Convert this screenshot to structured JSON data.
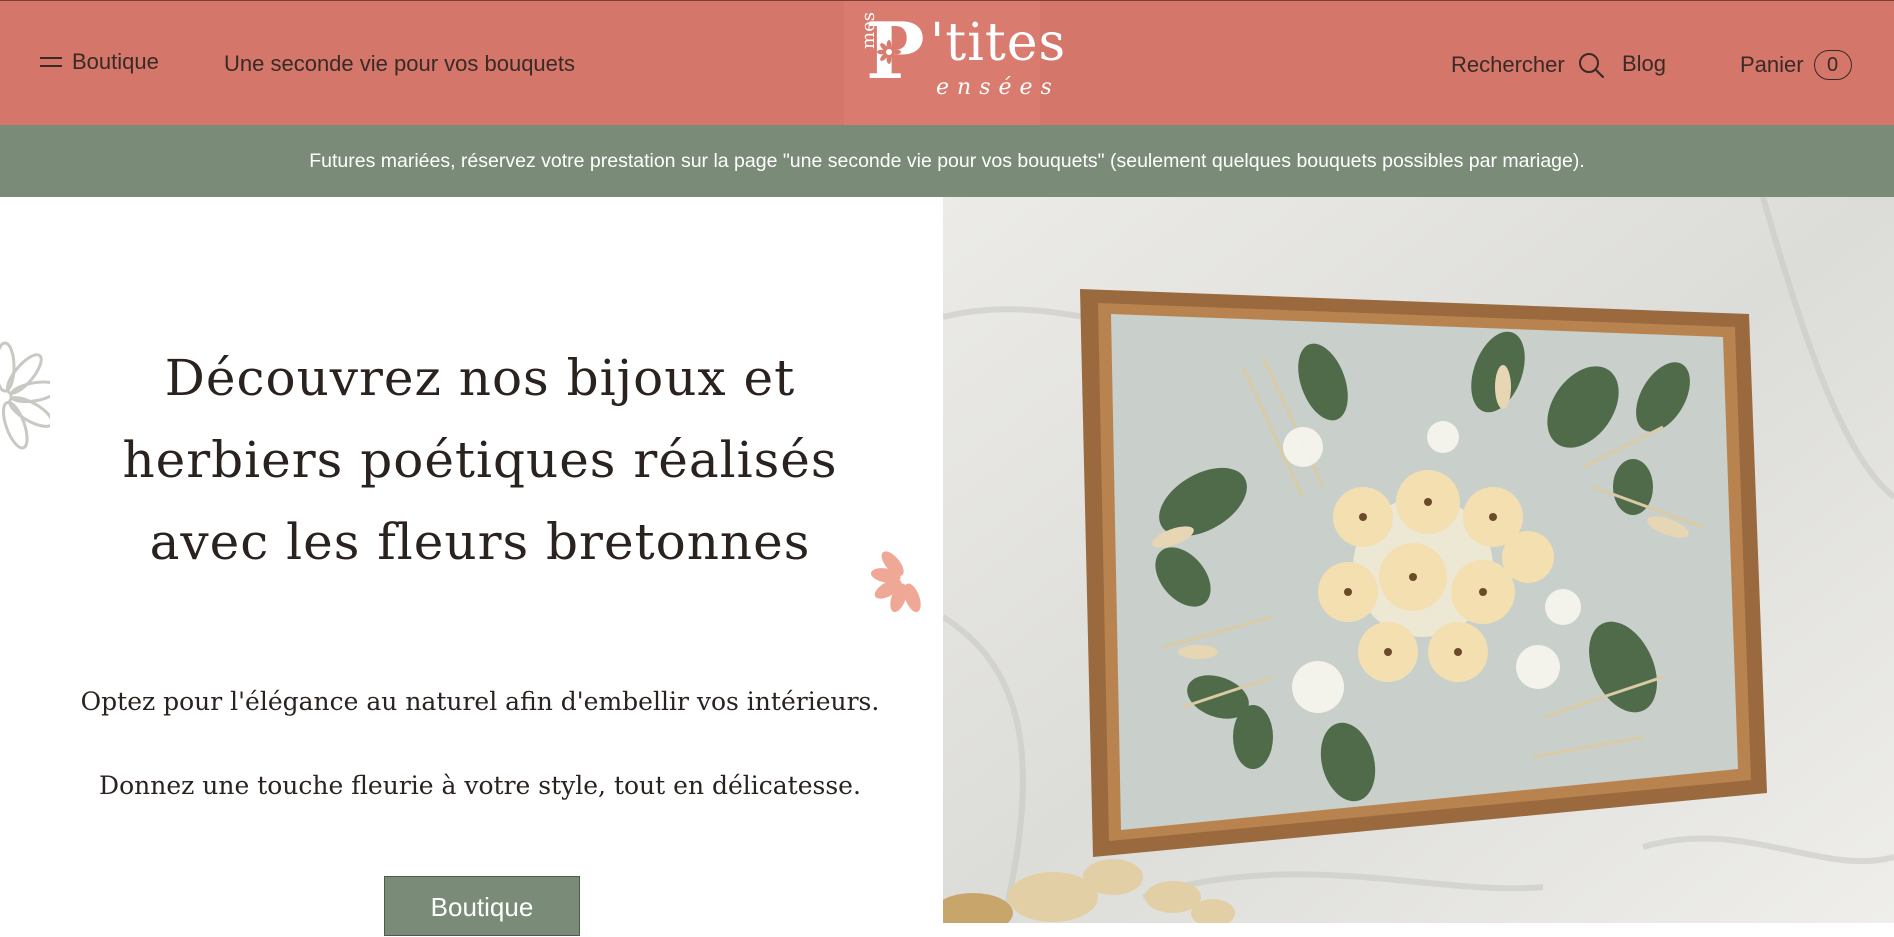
{
  "header": {
    "menu_label": "Boutique",
    "nav_link": "Une seconde vie pour vos bouquets",
    "logo": {
      "mes": "mes",
      "p": "P",
      "tites": "'tites",
      "ensees": "ensées"
    },
    "search_label": "Rechercher",
    "blog_label": "Blog",
    "cart_label": "Panier",
    "cart_count": "0"
  },
  "announcement": "Futures mariées, réservez votre prestation sur la page \"une seconde vie pour vos bouquets\" (seulement quelques bouquets possibles par mariage).",
  "hero": {
    "title_line1": "Découvrez nos bijoux et",
    "title_line2": "herbiers poétiques réalisés",
    "title_line3": "avec les fleurs bretonnes",
    "paragraph1": "Optez pour l'élégance au naturel afin d'embellir vos intérieurs.",
    "paragraph2": "Donnez une touche fleurie à votre style, tout en délicatesse.",
    "button_label": "Boutique"
  },
  "colors": {
    "header_bg": "#d4766a",
    "announcement_bg": "#7a8b78",
    "button_bg": "#7a8b78",
    "text_dark": "#2a221f",
    "petal_pink": "#f0a896"
  }
}
